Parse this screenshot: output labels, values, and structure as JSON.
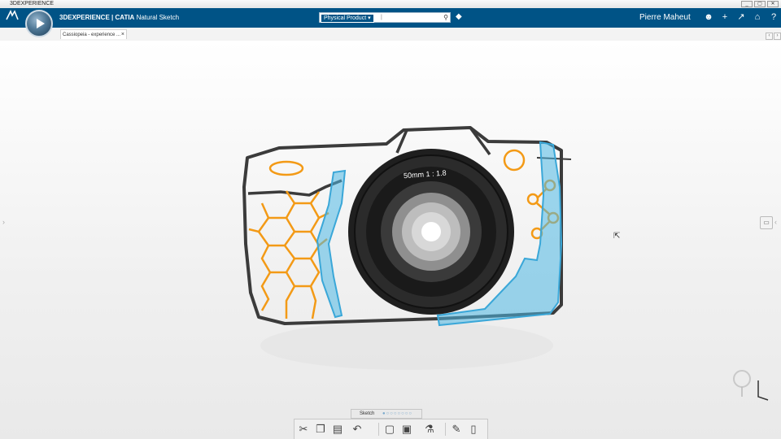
{
  "window": {
    "title": "3DEXPERIENCE",
    "minimize": "_",
    "restore": "▢",
    "close": "✕"
  },
  "topbar": {
    "brand_bold": "3DEXPERIENCE | CATIA",
    "brand_app": "Natural Sketch",
    "search_scope": "Physical Product ▾",
    "search_icon": "search-icon",
    "user_name": "Pierre Maheut",
    "icons": [
      "user-icon",
      "add-icon",
      "share-icon",
      "home-icon",
      "help-icon"
    ]
  },
  "tab": {
    "label": "Cassiopeia - experience ...",
    "close": "×"
  },
  "camera_sketch": {
    "lens_text": "50mm  1 : 1.8"
  },
  "sketch_bar": {
    "label": "Sketch",
    "dots": "●○○○○○○○"
  },
  "toolbar": {
    "tools": [
      "cut-icon",
      "copy-icon",
      "paste-icon",
      "undo-icon",
      "new-plane-icon",
      "fill-color-icon",
      "paint-icon",
      "pen-icon",
      "trash-icon"
    ]
  },
  "colors": {
    "topbar": "#005386",
    "orange": "#F39A16",
    "blue": "#4FB8E4"
  }
}
